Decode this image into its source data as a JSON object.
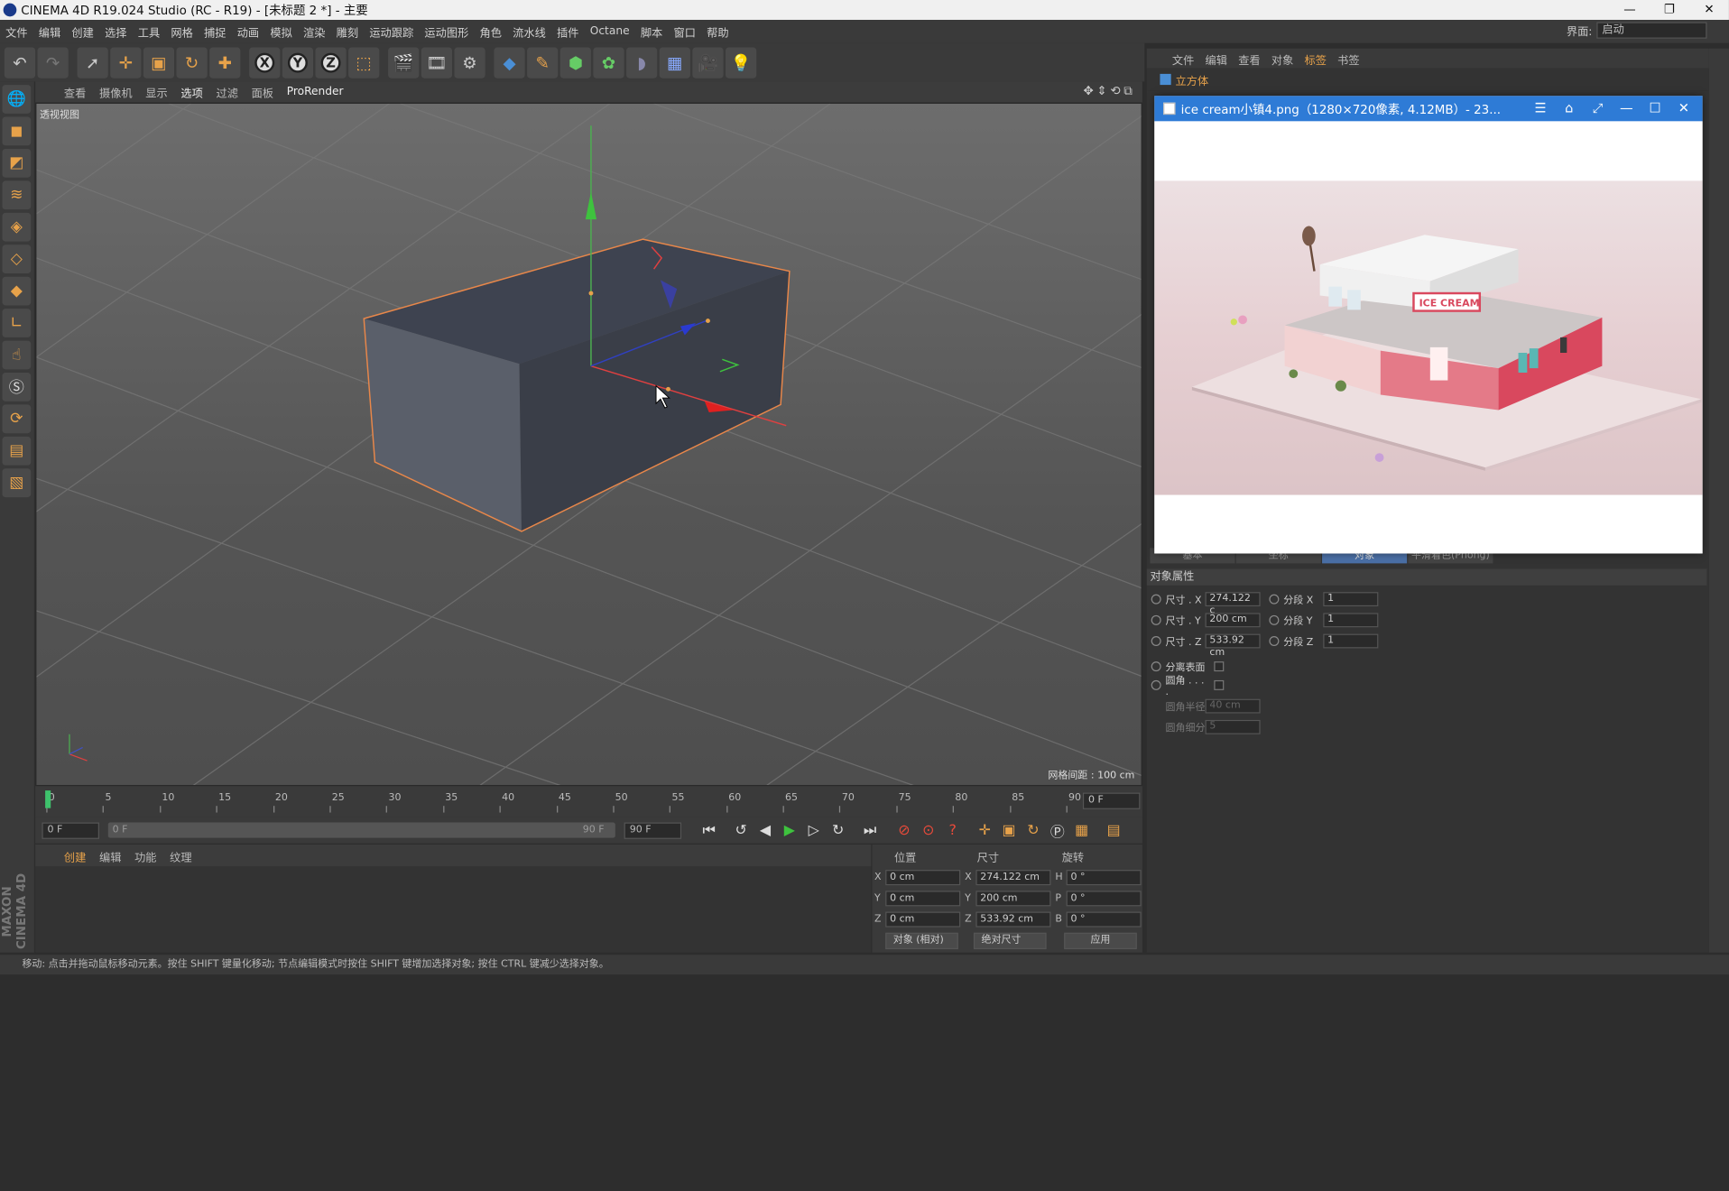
{
  "window": {
    "title": "CINEMA 4D R19.024 Studio (RC - R19) - [未标题 2 *] - 主要",
    "minimize": "—",
    "restore": "❐",
    "close": "✕"
  },
  "menu": {
    "items": [
      "文件",
      "编辑",
      "创建",
      "选择",
      "工具",
      "网格",
      "捕捉",
      "动画",
      "模拟",
      "渲染",
      "雕刻",
      "运动跟踪",
      "运动图形",
      "角色",
      "流水线",
      "插件",
      "Octane",
      "脚本",
      "窗口",
      "帮助"
    ],
    "layout_label": "界面:",
    "layout_value": "启动"
  },
  "toolbar": {
    "icons": [
      "undo-icon",
      "redo-icon",
      "live-select-icon",
      "move-icon",
      "scale-icon",
      "rotate-icon",
      "recent-tool-icon",
      "x-axis-icon",
      "y-axis-icon",
      "z-axis-icon",
      "coordinate-system-icon",
      "render-view-icon",
      "render-picture-viewer-icon",
      "render-settings-icon",
      "cube-icon",
      "pen-icon",
      "subdivision-icon",
      "cloner-icon",
      "deformer-icon",
      "floor-icon",
      "camera-icon",
      "light-icon"
    ],
    "axis_x": "X",
    "axis_y": "Y",
    "axis_z": "Z"
  },
  "viewport": {
    "menu": [
      "查看",
      "摄像机",
      "显示",
      "选项",
      "过滤",
      "面板",
      "ProRender"
    ],
    "active_menu": "选项",
    "label": "透视视图",
    "grid_spacing": "网格间距 : 100 cm",
    "nav_icons": "✥⇕⟲⧉"
  },
  "timeline": {
    "ticks": [
      "0",
      "5",
      "10",
      "15",
      "20",
      "25",
      "30",
      "35",
      "40",
      "45",
      "50",
      "55",
      "60",
      "65",
      "70",
      "75",
      "80",
      "85",
      "90"
    ],
    "current_frame": "0 F",
    "start": "0 F",
    "range_start": "0 F",
    "range_end": "90 F",
    "end": "90 F"
  },
  "materials": {
    "menu": [
      "创建",
      "编辑",
      "功能",
      "纹理"
    ]
  },
  "coordinates": {
    "headers": {
      "position": "位置",
      "size": "尺寸",
      "rotation": "旋转"
    },
    "rows": [
      {
        "axis": "X",
        "pos": "0 cm",
        "size": "274.122 cm",
        "rot_axis": "H",
        "rot": "0 °"
      },
      {
        "axis": "Y",
        "pos": "0 cm",
        "size": "200 cm",
        "rot_axis": "P",
        "rot": "0 °"
      },
      {
        "axis": "Z",
        "pos": "0 cm",
        "size": "533.92 cm",
        "rot_axis": "B",
        "rot": "0 °"
      }
    ],
    "mode": "对象 (相对)",
    "size_mode": "绝对尺寸",
    "apply": "应用"
  },
  "status": {
    "text": "移动: 点击并拖动鼠标移动元素。按住 SHIFT 键量化移动; 节点编辑模式时按住 SHIFT 键增加选择对象; 按住 CTRL 键减少选择对象。"
  },
  "object_manager": {
    "menu": [
      "文件",
      "编辑",
      "查看",
      "对象",
      "标签",
      "书签"
    ],
    "active_menu": "标签",
    "object_name": "立方体"
  },
  "attributes": {
    "tabs": [
      "基本",
      "坐标",
      "对象",
      "平滑着色(Phong)"
    ],
    "active_tab": "对象",
    "title": "对象属性",
    "size_x_label": "尺寸 . X",
    "size_x": "274.122 c",
    "size_y_label": "尺寸 . Y",
    "size_y": "200 cm",
    "size_z_label": "尺寸 . Z",
    "size_z": "533.92 cm",
    "seg_x_label": "分段 X",
    "seg_x": "1",
    "seg_y_label": "分段 Y",
    "seg_y": "1",
    "seg_z_label": "分段 Z",
    "seg_z": "1",
    "separate_surfaces": "分离表面",
    "fillet": "圆角 . . . .",
    "fillet_radius_label": "圆角半径",
    "fillet_radius": "40 cm",
    "fillet_subdiv_label": "圆角细分",
    "fillet_subdiv": "5"
  },
  "image_viewer": {
    "title": "ice cream小镇4.png（1280×720像素, 4.12MB）- 23...",
    "sign_text": "ICE CREAM"
  },
  "branding": {
    "logo_text": "MAXON CINEMA 4D"
  },
  "colors": {
    "accent": "#e7a24a",
    "selection_outline": "#e8874a",
    "viewer_title": "#2e7bd6"
  }
}
